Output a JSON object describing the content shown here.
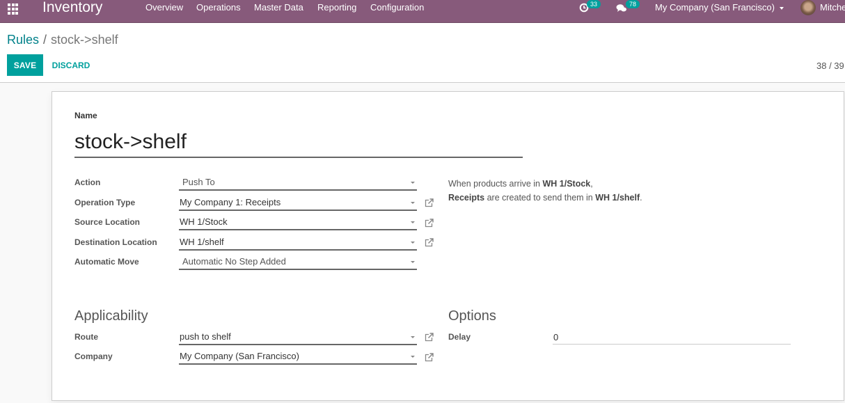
{
  "navbar": {
    "app_name": "Inventory",
    "menus": [
      "Overview",
      "Operations",
      "Master Data",
      "Reporting",
      "Configuration"
    ],
    "activity_count": "33",
    "message_count": "78",
    "company": "My Company (San Francisco)",
    "user_name": "Mitchell Admin",
    "colors": {
      "bar": "#875a7b",
      "badge": "#00a09d"
    }
  },
  "control_panel": {
    "breadcrumb_parent": "Rules",
    "breadcrumb_separator": "/",
    "breadcrumb_current": "stock->shelf",
    "save_label": "SAVE",
    "discard_label": "DISCARD",
    "pager": "38 / 39"
  },
  "form": {
    "name_label": "Name",
    "name_value": "stock->shelf",
    "fields": [
      {
        "label": "Action",
        "value": "Push To",
        "kind": "selection",
        "external_link": false
      },
      {
        "label": "Operation Type",
        "value": "My Company 1: Receipts",
        "kind": "many2one",
        "external_link": true
      },
      {
        "label": "Source Location",
        "value": "WH 1/Stock",
        "kind": "many2one",
        "external_link": true
      },
      {
        "label": "Destination Location",
        "value": "WH 1/shelf",
        "kind": "many2one",
        "external_link": true
      },
      {
        "label": "Automatic Move",
        "value": "Automatic No Step Added",
        "kind": "selection",
        "external_link": false
      }
    ],
    "help": {
      "line1_prefix": "When products arrive in ",
      "line1_bold": "WH 1/Stock",
      "line1_suffix": ",",
      "line2_bold1": "Receipts",
      "line2_mid": " are created to send them in ",
      "line2_bold2": "WH 1/shelf",
      "line2_suffix": "."
    },
    "applicability": {
      "title": "Applicability",
      "fields": [
        {
          "label": "Route",
          "value": "push to shelf",
          "external_link": true
        },
        {
          "label": "Company",
          "value": "My Company (San Francisco)",
          "external_link": true
        }
      ]
    },
    "options": {
      "title": "Options",
      "delay_label": "Delay",
      "delay_value": "0"
    }
  },
  "icons": {
    "apps": "apps-grid-icon",
    "activity": "clock-icon",
    "messages": "chat-bubbles-icon",
    "external": "external-link-icon",
    "dropdown": "caret-down-icon"
  }
}
